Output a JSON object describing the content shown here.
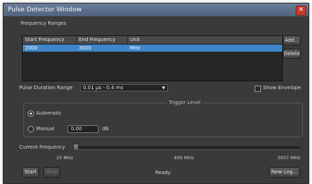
{
  "window": {
    "title": "Pulse Detector Window",
    "close_glyph": "✕"
  },
  "frequency": {
    "section_label": "Frequency Ranges",
    "columns": [
      "Start Frequency",
      "End Frequency",
      "Unit"
    ],
    "rows": [
      {
        "start": "2000",
        "end": "3000",
        "unit": "MHz"
      }
    ],
    "add_label": "Add...",
    "delete_label": "Delete"
  },
  "pulse": {
    "label": "Pulse Duration Range",
    "selected": "0.01 µs - 0.4 ms",
    "show_envelope_label": "Show Envelope",
    "show_envelope_checked": false
  },
  "trigger": {
    "group_label": "Trigger Level",
    "automatic_label": "Automatic",
    "manual_label": "Manual",
    "manual_value": "0.00",
    "unit": "dB",
    "selected": "automatic"
  },
  "current_frequency": {
    "label": "Current Frequency",
    "ticks": [
      "10 MHz",
      "400 MHz",
      "3007 MHz"
    ],
    "value_fraction": 0.0
  },
  "footer": {
    "start_label": "Start",
    "stop_label": "Stop",
    "status": "Ready",
    "new_log_label": "New Log..."
  }
}
